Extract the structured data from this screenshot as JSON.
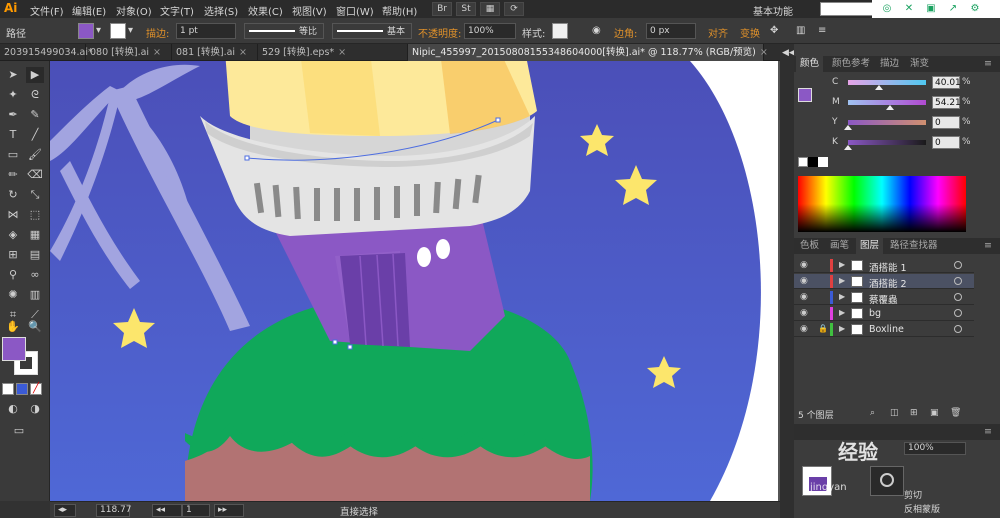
{
  "menubar": {
    "logo": "Ai",
    "menus": [
      "文件(F)",
      "编辑(E)",
      "对象(O)",
      "文字(T)",
      "选择(S)",
      "效果(C)",
      "视图(V)",
      "窗口(W)",
      "帮助(H)"
    ],
    "workspace": "基本功能",
    "window_icons": [
      "bookmark-icon",
      "expand-icon",
      "save-icon",
      "share-icon",
      "settings-icon"
    ]
  },
  "controlbar": {
    "selection_label": "路径",
    "fill_color": "#8b58c5",
    "stroke_label": "描边:",
    "stroke_weight": "1 pt",
    "profile_label": "等比",
    "brush_label": "基本",
    "opacity_label": "不透明度:",
    "opacity_value": "100%",
    "style_label": "样式:",
    "corner_label": "边角:",
    "corner_value": "0 px",
    "align_label": "对齐",
    "transform_label": "变换"
  },
  "tabs": [
    {
      "label": "203915499034.ai*",
      "active": false
    },
    {
      "label": "080 [转换].ai",
      "active": false
    },
    {
      "label": "081 [转换].ai",
      "active": false
    },
    {
      "label": "529 [转换].eps*",
      "active": false
    },
    {
      "label": "Nipic_455997_20150808155348604000[转换].ai* @ 118.77% (RGB/预览)",
      "active": true
    }
  ],
  "statusbar": {
    "zoom": "118.77",
    "page": "1",
    "tool_name": "直接选择"
  },
  "color_panel": {
    "tabs": [
      "颜色",
      "颜色参考",
      "描边",
      "渐变"
    ],
    "channels": [
      {
        "name": "C",
        "value": "40.01",
        "knob": 0.4
      },
      {
        "name": "M",
        "value": "54.21",
        "knob": 0.54
      },
      {
        "name": "Y",
        "value": "0",
        "knob": 0.0
      },
      {
        "name": "K",
        "value": "0",
        "knob": 0.0
      }
    ],
    "pct": "%"
  },
  "layers_panel": {
    "tabs": [
      "色板",
      "画笔",
      "图层",
      "路径查找器"
    ],
    "layers": [
      {
        "name": "酒搭能 1",
        "color": "#e04040",
        "selected": false
      },
      {
        "name": "酒搭能 2",
        "color": "#e04040",
        "selected": true
      },
      {
        "name": "蔡覆蟲",
        "color": "#3b5bd6",
        "selected": false
      },
      {
        "name": "bg",
        "color": "#e040e0",
        "selected": false
      },
      {
        "name": "Boxline",
        "color": "#40c040",
        "selected": false
      }
    ],
    "count": "5 个图层"
  },
  "transparency": {
    "value": "100%",
    "checkbox_label": "反相蒙版",
    "mask_label": "剪切"
  },
  "watermark": {
    "text": "经验",
    "sub": "jingyan"
  }
}
